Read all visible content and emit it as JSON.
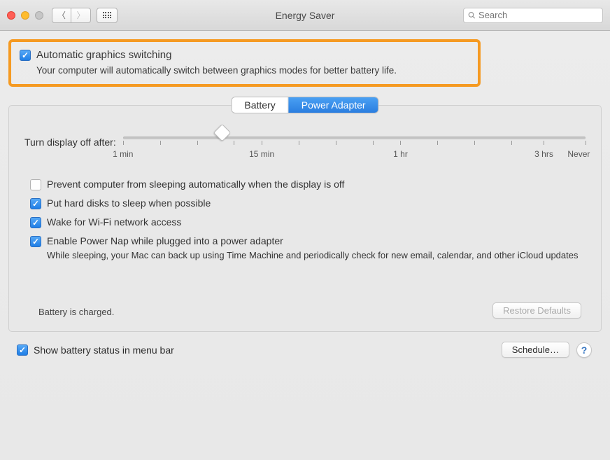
{
  "window": {
    "title": "Energy Saver"
  },
  "search": {
    "placeholder": "Search"
  },
  "highlight": {
    "checked": true,
    "title": "Automatic graphics switching",
    "subtitle": "Your computer will automatically switch between graphics modes for better battery life."
  },
  "tabs": {
    "battery": "Battery",
    "power_adapter": "Power Adapter",
    "active": "power_adapter"
  },
  "slider": {
    "label": "Turn display off after:",
    "ticks": [
      "1 min",
      "15 min",
      "1 hr",
      "3 hrs",
      "Never"
    ]
  },
  "options": [
    {
      "checked": false,
      "label": "Prevent computer from sleeping automatically when the display is off",
      "desc": ""
    },
    {
      "checked": true,
      "label": "Put hard disks to sleep when possible",
      "desc": ""
    },
    {
      "checked": true,
      "label": "Wake for Wi-Fi network access",
      "desc": ""
    },
    {
      "checked": true,
      "label": "Enable Power Nap while plugged into a power adapter",
      "desc": "While sleeping, your Mac can back up using Time Machine and periodically check for new email, calendar, and other iCloud updates"
    }
  ],
  "status": "Battery is charged.",
  "buttons": {
    "restore": "Restore Defaults",
    "schedule": "Schedule…"
  },
  "footer_checkbox": {
    "checked": true,
    "label": "Show battery status in menu bar"
  }
}
